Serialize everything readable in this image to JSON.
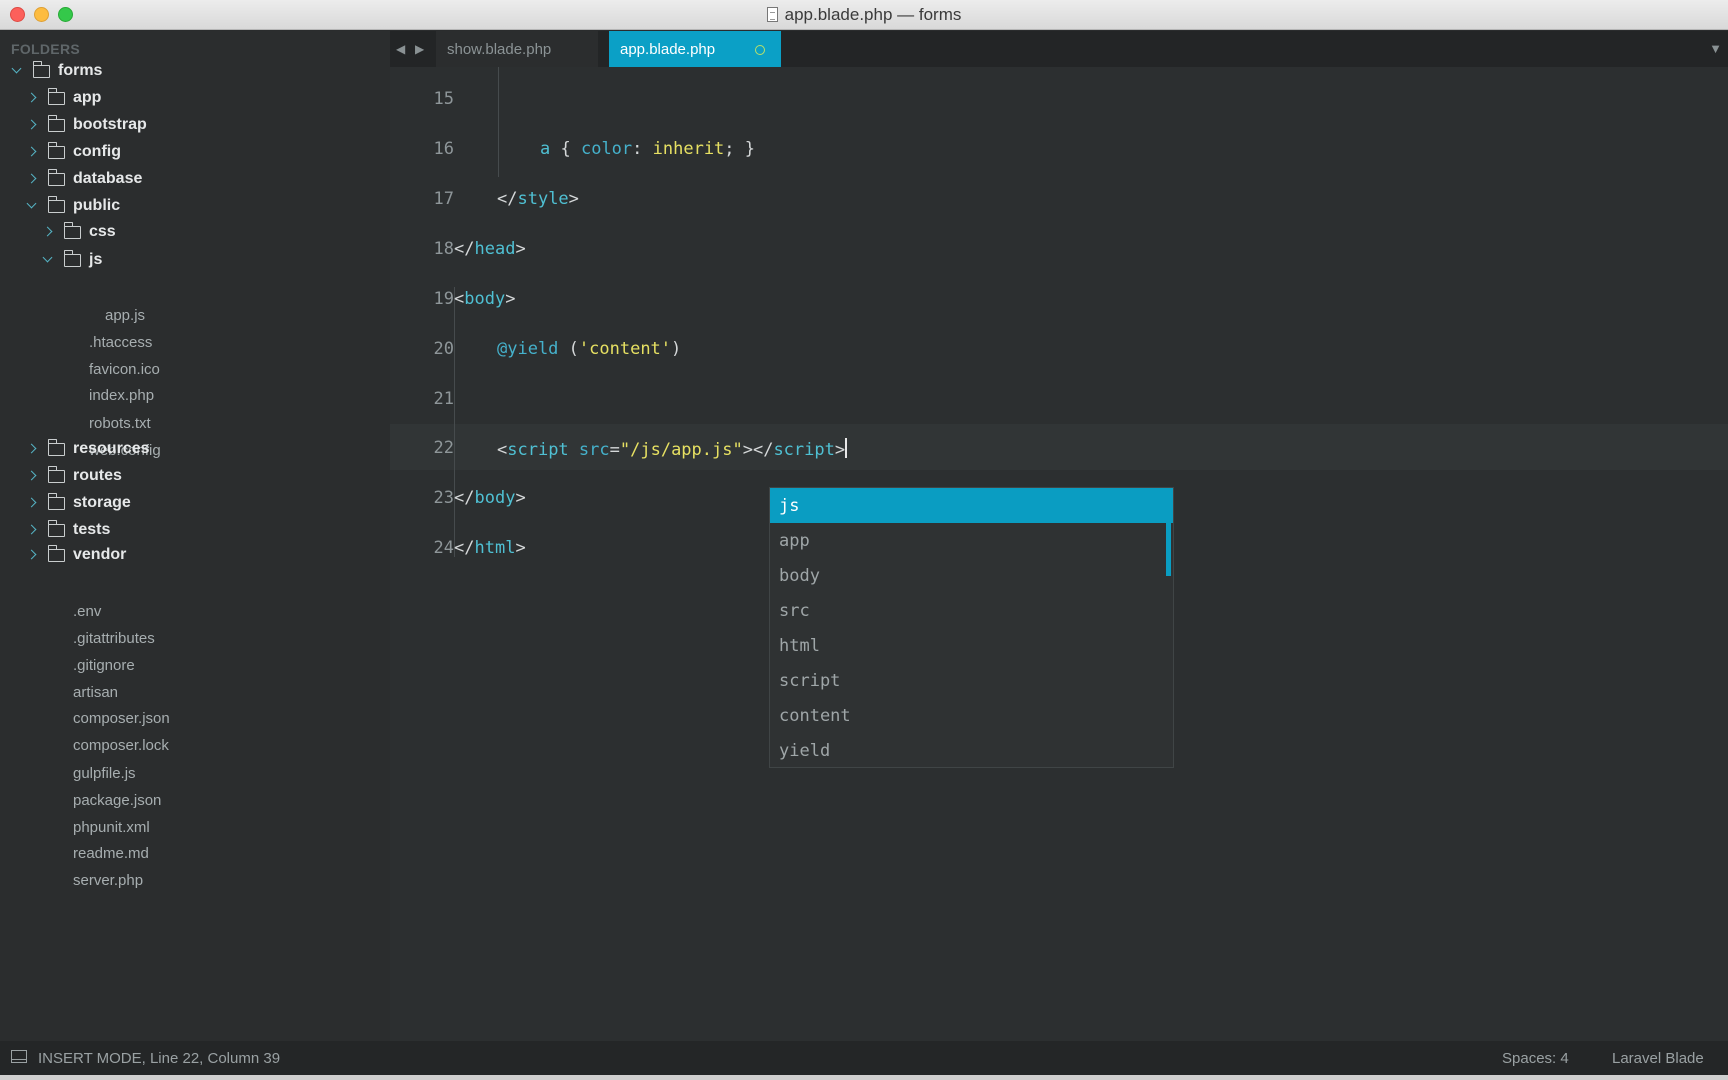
{
  "window": {
    "title": "app.blade.php — forms"
  },
  "sidebar": {
    "header": "FOLDERS",
    "tree": [
      {
        "label": "forms",
        "type": "folder",
        "expanded": true
      },
      {
        "label": "app",
        "type": "folder",
        "expanded": false
      },
      {
        "label": "bootstrap",
        "type": "folder",
        "expanded": false
      },
      {
        "label": "config",
        "type": "folder",
        "expanded": false
      },
      {
        "label": "database",
        "type": "folder",
        "expanded": false
      },
      {
        "label": "public",
        "type": "folder",
        "expanded": true
      },
      {
        "label": "css",
        "type": "folder",
        "expanded": false
      },
      {
        "label": "js",
        "type": "folder",
        "expanded": true
      },
      {
        "label": "app.js",
        "type": "file"
      },
      {
        "label": ".htaccess",
        "type": "file"
      },
      {
        "label": "favicon.ico",
        "type": "file"
      },
      {
        "label": "index.php",
        "type": "file"
      },
      {
        "label": "robots.txt",
        "type": "file"
      },
      {
        "label": "web.config",
        "type": "file"
      },
      {
        "label": "resources",
        "type": "folder",
        "expanded": false
      },
      {
        "label": "routes",
        "type": "folder",
        "expanded": false
      },
      {
        "label": "storage",
        "type": "folder",
        "expanded": false
      },
      {
        "label": "tests",
        "type": "folder",
        "expanded": false
      },
      {
        "label": "vendor",
        "type": "folder",
        "expanded": false
      },
      {
        "label": ".env",
        "type": "file"
      },
      {
        "label": ".gitattributes",
        "type": "file"
      },
      {
        "label": ".gitignore",
        "type": "file"
      },
      {
        "label": "artisan",
        "type": "file"
      },
      {
        "label": "composer.json",
        "type": "file"
      },
      {
        "label": "composer.lock",
        "type": "file"
      },
      {
        "label": "gulpfile.js",
        "type": "file"
      },
      {
        "label": "package.json",
        "type": "file"
      },
      {
        "label": "phpunit.xml",
        "type": "file"
      },
      {
        "label": "readme.md",
        "type": "file"
      },
      {
        "label": "server.php",
        "type": "file"
      }
    ]
  },
  "tabs": {
    "prev": "◀",
    "next": "▶",
    "items": [
      {
        "label": "show.blade.php",
        "active": false
      },
      {
        "label": "app.blade.php",
        "active": true,
        "dirty": true
      }
    ],
    "dropdown": "▼"
  },
  "editor": {
    "line_numbers": [
      "15",
      "16",
      "17",
      "18",
      "19",
      "20",
      "21",
      "22",
      "23",
      "24"
    ],
    "current_line": "22",
    "code": {
      "l16": {
        "sel": "a",
        "open": " { ",
        "prop": "color",
        "colon": ": ",
        "val": "inherit",
        "semi": "; }"
      },
      "l17": {
        "open": "</",
        "tag": "style",
        "close": ">"
      },
      "l18": {
        "open": "</",
        "tag": "head",
        "close": ">"
      },
      "l19": {
        "open": "<",
        "tag": "body",
        "close": ">"
      },
      "l20": {
        "directive": "@yield",
        "paren_open": " (",
        "str": "'content'",
        "paren_close": ")"
      },
      "l22": {
        "open": "<",
        "tag": "script",
        "sp": " ",
        "attr": "src",
        "eq": "=",
        "str": "\"/js/app.js\"",
        "mid": "></",
        "tag2": "script",
        "close": ">"
      },
      "l23": {
        "open": "</",
        "tag": "body",
        "close": ">"
      },
      "l24": {
        "open": "</",
        "tag": "html",
        "close": ">"
      }
    }
  },
  "autocomplete": {
    "items": [
      "js",
      "app",
      "body",
      "src",
      "html",
      "script",
      "content",
      "yield"
    ],
    "selected": 0
  },
  "statusbar": {
    "mode": "INSERT MODE, Line 22, Column 39",
    "spaces": "Spaces: 4",
    "syntax": "Laravel Blade"
  },
  "colors": {
    "accent": "#0ba0c6",
    "tag": "#4fc0d3",
    "string": "#e6e062",
    "dirty_indicator": "#b8e06a"
  }
}
